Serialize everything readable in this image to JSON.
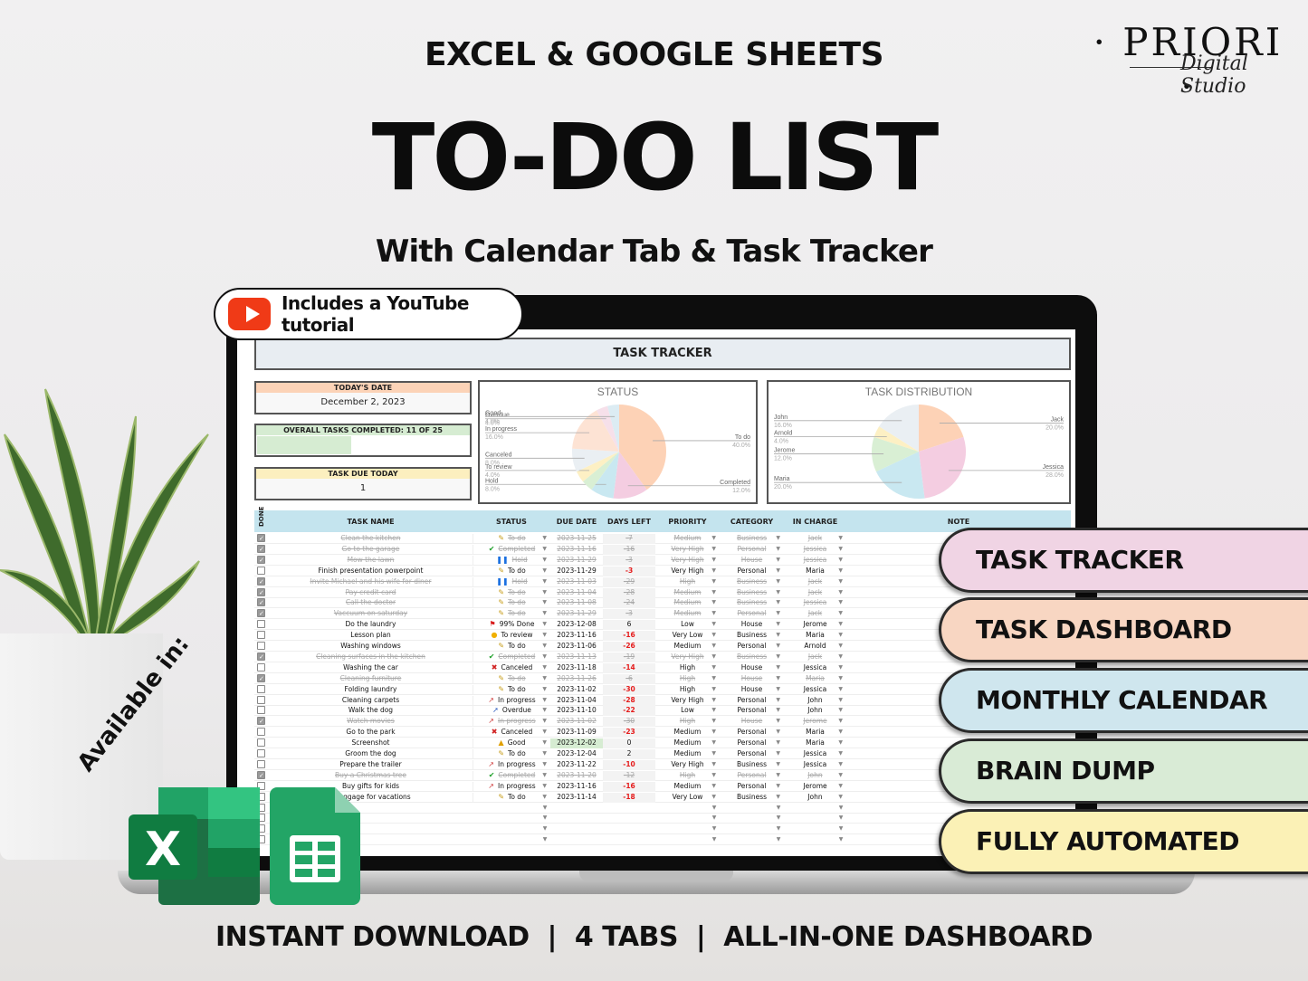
{
  "header": {
    "kicker": "EXCEL & GOOGLE SHEETS",
    "title": "TO-DO LIST",
    "subtitle": "With Calendar Tab & Task Tracker"
  },
  "logo": {
    "brand": "· PRIORI ·",
    "script": "Digital Studio"
  },
  "youtube_badge": {
    "label": "Includes a YouTube tutorial",
    "icon": "youtube-play-icon",
    "color": "#f03a17"
  },
  "sheet": {
    "title": "TASK TRACKER",
    "todays_date": {
      "label": "TODAY'S DATE",
      "value": "December 2, 2023"
    },
    "overall": {
      "label": "OVERALL TASKS COMPLETED: 11 OF 25",
      "progress": 0.44
    },
    "due_today": {
      "label": "TASK DUE TODAY",
      "value": "1"
    },
    "columns": [
      "DONE",
      "TASK NAME",
      "STATUS",
      "DUE DATE",
      "DAYS LEFT",
      "PRIORITY",
      "CATEGORY",
      "IN CHARGE",
      "NOTE"
    ],
    "rows": [
      {
        "done": true,
        "task": "Clean the kitchen",
        "status": "To do",
        "due": "2023-11-25",
        "days": "-7",
        "priority": "Medium",
        "category": "Business",
        "who": "Jack"
      },
      {
        "done": true,
        "task": "Go to the garage",
        "status": "Completed",
        "due": "2023-11-16",
        "days": "-16",
        "priority": "Very High",
        "category": "Personal",
        "who": "Jessica"
      },
      {
        "done": true,
        "task": "Mow the lawn",
        "status": "Hold",
        "due": "2023-11-29",
        "days": "-3",
        "priority": "Very High",
        "category": "House",
        "who": "Jessica"
      },
      {
        "done": false,
        "task": "Finish presentation powerpoint",
        "status": "To do",
        "due": "2023-11-29",
        "days": "-3",
        "priority": "Very High",
        "category": "Personal",
        "who": "Maria"
      },
      {
        "done": true,
        "task": "Invite Michael and his wife for diner",
        "status": "Hold",
        "due": "2023-11-03",
        "days": "-29",
        "priority": "High",
        "category": "Business",
        "who": "Jack"
      },
      {
        "done": true,
        "task": "Pay credit card",
        "status": "To do",
        "due": "2023-11-04",
        "days": "-28",
        "priority": "Medium",
        "category": "Business",
        "who": "Jack"
      },
      {
        "done": true,
        "task": "Call the doctor",
        "status": "To do",
        "due": "2023-11-08",
        "days": "-24",
        "priority": "Medium",
        "category": "Business",
        "who": "Jessica"
      },
      {
        "done": true,
        "task": "Vaccuum on saturday",
        "status": "To do",
        "due": "2023-11-29",
        "days": "-3",
        "priority": "Medium",
        "category": "Personal",
        "who": "Jack"
      },
      {
        "done": false,
        "task": "Do the laundry",
        "status": "99% Done",
        "due": "2023-12-08",
        "days": "6",
        "priority": "Low",
        "category": "House",
        "who": "Jerome"
      },
      {
        "done": false,
        "task": "Lesson plan",
        "status": "To review",
        "due": "2023-11-16",
        "days": "-16",
        "priority": "Very Low",
        "category": "Business",
        "who": "Maria"
      },
      {
        "done": false,
        "task": "Washing windows",
        "status": "To do",
        "due": "2023-11-06",
        "days": "-26",
        "priority": "Medium",
        "category": "Personal",
        "who": "Arnold"
      },
      {
        "done": true,
        "task": "Cleaning surfaces in the kitchen",
        "status": "Completed",
        "due": "2023-11-13",
        "days": "-19",
        "priority": "Very High",
        "category": "Business",
        "who": "Jack"
      },
      {
        "done": false,
        "task": "Washing the car",
        "status": "Canceled",
        "due": "2023-11-18",
        "days": "-14",
        "priority": "High",
        "category": "House",
        "who": "Jessica"
      },
      {
        "done": true,
        "task": "Cleaning furniture",
        "status": "To do",
        "due": "2023-11-26",
        "days": "-6",
        "priority": "High",
        "category": "House",
        "who": "Maria"
      },
      {
        "done": false,
        "task": "Folding laundry",
        "status": "To do",
        "due": "2023-11-02",
        "days": "-30",
        "priority": "High",
        "category": "House",
        "who": "Jessica"
      },
      {
        "done": false,
        "task": "Cleaning carpets",
        "status": "In progress",
        "due": "2023-11-04",
        "days": "-28",
        "priority": "Very High",
        "category": "Personal",
        "who": "John"
      },
      {
        "done": false,
        "task": "Walk the dog",
        "status": "Overdue",
        "due": "2023-11-10",
        "days": "-22",
        "priority": "Low",
        "category": "Personal",
        "who": "John"
      },
      {
        "done": true,
        "task": "Watch movies",
        "status": "In progress",
        "due": "2023-11-02",
        "days": "-30",
        "priority": "High",
        "category": "House",
        "who": "Jerome"
      },
      {
        "done": false,
        "task": "Go to the park",
        "status": "Canceled",
        "due": "2023-11-09",
        "days": "-23",
        "priority": "Medium",
        "category": "Personal",
        "who": "Maria"
      },
      {
        "done": false,
        "task": "Screenshot",
        "status": "Good",
        "due": "2023-12-02",
        "days": "0",
        "priority": "Medium",
        "category": "Personal",
        "who": "Maria",
        "today": true
      },
      {
        "done": false,
        "task": "Groom the dog",
        "status": "To do",
        "due": "2023-12-04",
        "days": "2",
        "priority": "Medium",
        "category": "Personal",
        "who": "Jessica"
      },
      {
        "done": false,
        "task": "Prepare the trailer",
        "status": "In progress",
        "due": "2023-11-22",
        "days": "-10",
        "priority": "Very High",
        "category": "Business",
        "who": "Jessica"
      },
      {
        "done": true,
        "task": "Buy a Christmas tree",
        "status": "Completed",
        "due": "2023-11-20",
        "days": "-12",
        "priority": "High",
        "category": "Personal",
        "who": "John"
      },
      {
        "done": false,
        "task": "Buy gifts for kids",
        "status": "In progress",
        "due": "2023-11-16",
        "days": "-16",
        "priority": "Medium",
        "category": "Personal",
        "who": "Jerome"
      },
      {
        "done": false,
        "task": "e luggage for vacations",
        "status": "To do",
        "due": "2023-11-14",
        "days": "-18",
        "priority": "Very Low",
        "category": "Business",
        "who": "John"
      }
    ]
  },
  "chart_data": [
    {
      "type": "pie",
      "title": "STATUS",
      "slices": [
        {
          "name": "To do",
          "value": 40.0,
          "color": "#fdd2b6",
          "label": "40.0%"
        },
        {
          "name": "Completed",
          "value": 12.0,
          "color": "#f4cde1",
          "label": "12.0%"
        },
        {
          "name": "Hold",
          "value": 8.0,
          "color": "#c9e8f1",
          "label": "8.0%"
        },
        {
          "name": "",
          "value": 4.0,
          "color": "#d9efd4"
        },
        {
          "name": "To review",
          "value": 4.0,
          "color": "#fdf0c4",
          "label": "4.0%"
        },
        {
          "name": "Canceled",
          "value": 8.0,
          "color": "#eaeff3",
          "label": "8.0%"
        },
        {
          "name": "In progress",
          "value": 16.0,
          "color": "#fde3d4",
          "label": "16.0%"
        },
        {
          "name": "Overdue",
          "value": 4.0,
          "color": "#f6e0ea",
          "label": "4.0%"
        },
        {
          "name": "Good",
          "value": 4.0,
          "color": "#dcecf3",
          "label": "4.0%"
        }
      ]
    },
    {
      "type": "pie",
      "title": "TASK DISTRIBUTION",
      "slices": [
        {
          "name": "Jack",
          "value": 20.0,
          "color": "#fdd2b6",
          "label": "20.0%"
        },
        {
          "name": "Jessica",
          "value": 28.0,
          "color": "#f4cde1",
          "label": "28.0%"
        },
        {
          "name": "Maria",
          "value": 20.0,
          "color": "#c9e8f1",
          "label": "20.0%"
        },
        {
          "name": "Jerome",
          "value": 12.0,
          "color": "#d9efd4",
          "label": "12.0%"
        },
        {
          "name": "Arnold",
          "value": 4.0,
          "color": "#fdf0c4",
          "label": "4.0%"
        },
        {
          "name": "John",
          "value": 16.0,
          "color": "#eaeff3",
          "label": "16.0%"
        }
      ]
    }
  ],
  "tabs": [
    {
      "label": "TASK TRACKER",
      "color": "#f0d4e4"
    },
    {
      "label": "TASK DASHBOARD",
      "color": "#f8d6c2"
    },
    {
      "label": "MONTHLY CALENDAR",
      "color": "#cfe6ee"
    },
    {
      "label": "BRAIN DUMP",
      "color": "#d9ebd6"
    },
    {
      "label": "FULLY AUTOMATED",
      "color": "#fbf1b6"
    }
  ],
  "available": {
    "label": "Available in:",
    "apps": [
      "excel-icon",
      "google-sheets-icon"
    ]
  },
  "footer": "INSTANT DOWNLOAD  |  4 TABS  |  ALL-IN-ONE DASHBOARD"
}
